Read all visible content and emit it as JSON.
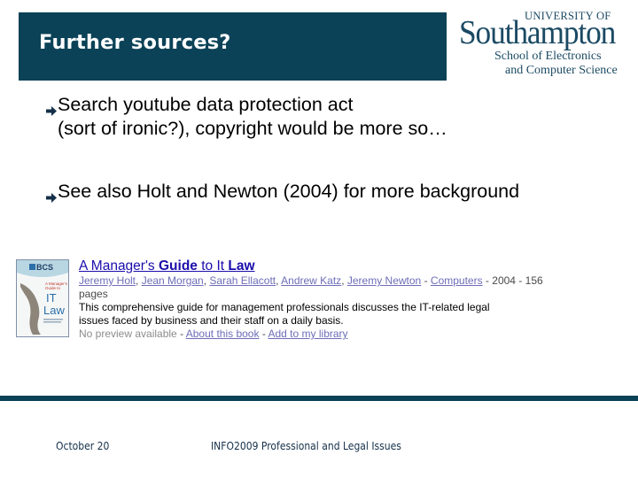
{
  "slide": {
    "title": "Further sources?",
    "colors": {
      "brand": "#0b4257",
      "link": "#1a0dab",
      "visited_link": "#6d6db8",
      "muted": "#8c8c8c"
    }
  },
  "logo": {
    "line1": "UNIVERSITY OF",
    "line2": "Southampton",
    "line3": "School of Electronics",
    "line4": "and Computer Science"
  },
  "bullets": [
    {
      "icon": "arrow-right-icon",
      "lines": [
        "Search youtube data protection act",
        "(sort of ironic?), copyright would be more so…"
      ]
    },
    {
      "icon": "arrow-right-icon",
      "lines": [
        "See also Holt and Newton (2004) for more background"
      ]
    }
  ],
  "book_result": {
    "cover": {
      "publisher": "BCS",
      "subtitle_line1": "A Manager's",
      "subtitle_line2": "Guide to",
      "big_line1": "IT",
      "big_line2": "Law"
    },
    "title_parts": {
      "p1": "A Manager's ",
      "p2": "Guide",
      "p3": " to It ",
      "p4": "Law"
    },
    "authors": [
      "Jeremy Holt",
      "Jean Morgan",
      "Sarah Ellacott",
      "Andrew Katz",
      "Jeremy Newton"
    ],
    "author_sep": ", ",
    "dash": " - ",
    "category": "Computers",
    "year": "2004",
    "pages_num": "156",
    "pages_label": "pages",
    "description_line1": "This comprehensive guide for management professionals discusses the IT-related legal",
    "description_line2": "issues faced by business and their staff on a daily basis.",
    "preview_status": "No preview available",
    "about_link": "About this book",
    "library_link": "Add to my library"
  },
  "footer": {
    "date": "October 20",
    "course": "INFO2009 Professional and Legal Issues"
  }
}
